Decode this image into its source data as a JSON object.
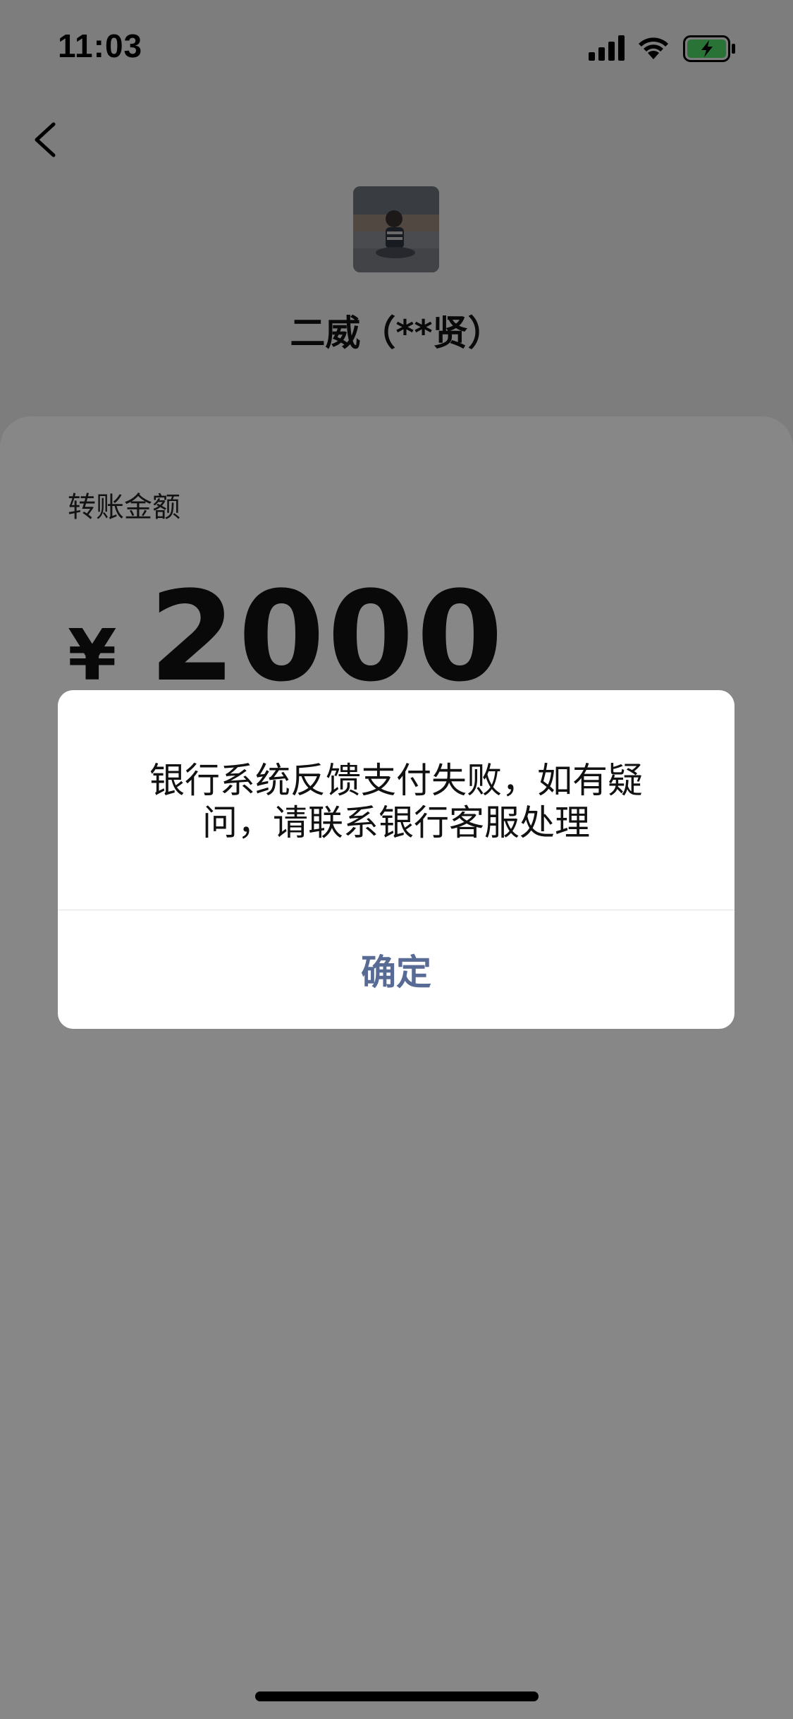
{
  "status_bar": {
    "time": "11:03",
    "signal_icon": "cellular-signal-icon",
    "wifi_icon": "wifi-icon",
    "battery_icon": "battery-charging-icon",
    "battery_color": "#4cd964"
  },
  "header": {
    "back_icon": "chevron-left-icon",
    "avatar_icon": "avatar",
    "recipient_name": "二威（**贤）"
  },
  "transfer": {
    "amount_label": "转账金额",
    "currency_symbol": "¥",
    "amount": "2000"
  },
  "alert": {
    "message": "银行系统反馈支付失败，如有疑问，请联系银行客服处理",
    "confirm_label": "确定",
    "confirm_color": "#576b95"
  }
}
